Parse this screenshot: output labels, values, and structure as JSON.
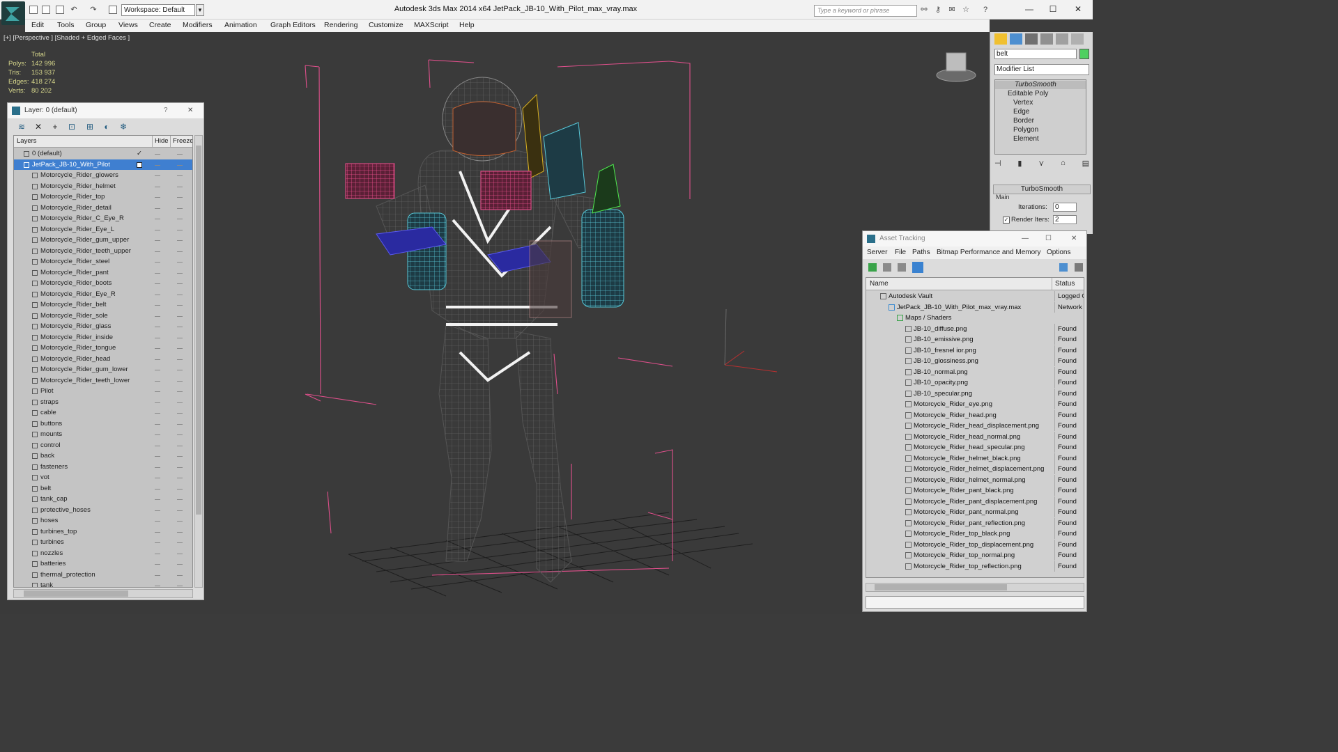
{
  "titlebar": {
    "workspace": "Workspace: Default",
    "app_title": "Autodesk 3ds Max  2014 x64       JetPack_JB-10_With_Pilot_max_vray.max",
    "search_placeholder": "Type a keyword or phrase"
  },
  "menu": [
    "Edit",
    "Tools",
    "Group",
    "Views",
    "Create",
    "Modifiers",
    "Animation",
    "Graph Editors",
    "Rendering",
    "Customize",
    "MAXScript",
    "Help"
  ],
  "viewport": {
    "label": "[+] [Perspective ] [Shaded + Edged Faces ]",
    "stats": {
      "header": "Total",
      "rows": [
        {
          "k": "Polys:",
          "v": "142 996"
        },
        {
          "k": "Tris:",
          "v": "153 937"
        },
        {
          "k": "Edges:",
          "v": "418 274"
        },
        {
          "k": "Verts:",
          "v": "80 202"
        }
      ]
    }
  },
  "layer_panel": {
    "title": "Layer: 0 (default)",
    "help": "?",
    "close": "✕",
    "col_layers": "Layers",
    "col_hide": "Hide",
    "col_freeze": "Freeze",
    "layers": [
      "0 (default)",
      "JetPack_JB-10_With_Pilot",
      "Motorcycle_Rider_glowers",
      "Motorcycle_Rider_helmet",
      "Motorcycle_Rider_top",
      "Motorcycle_Rider_detail",
      "Motorcycle_Rider_C_Eye_R",
      "Motorcycle_Rider_Eye_L",
      "Motorcycle_Rider_gum_upper",
      "Motorcycle_Rider_teeth_upper",
      "Motorcycle_Rider_steel",
      "Motorcycle_Rider_pant",
      "Motorcycle_Rider_boots",
      "Motorcycle_Rider_Eye_R",
      "Motorcycle_Rider_belt",
      "Motorcycle_Rider_sole",
      "Motorcycle_Rider_glass",
      "Motorcycle_Rider_inside",
      "Motorcycle_Rider_tongue",
      "Motorcycle_Rider_head",
      "Motorcycle_Rider_gum_lower",
      "Motorcycle_Rider_teeth_lower",
      "Pilot",
      "straps",
      "cable",
      "buttons",
      "mounts",
      "control",
      "back",
      "fasteners",
      "vot",
      "belt",
      "tank_cap",
      "protective_hoses",
      "hoses",
      "turbines_top",
      "turbines",
      "nozzles",
      "batteries",
      "thermal_protection",
      "tank"
    ]
  },
  "command_panel": {
    "object_name": "belt",
    "modifier_list": "Modifier List",
    "stack": [
      "TurboSmooth",
      "Editable Poly",
      "Vertex",
      "Edge",
      "Border",
      "Polygon",
      "Element"
    ],
    "rollout": "TurboSmooth",
    "group": "Main",
    "iterations_label": "Iterations:",
    "iterations": "0",
    "render_iters_label": "Render Iters:",
    "render_iters": "2"
  },
  "asset_panel": {
    "title": "Asset Tracking",
    "menu": [
      "Server",
      "File",
      "Paths",
      "Bitmap Performance and Memory",
      "Options"
    ],
    "col_name": "Name",
    "col_status": "Status",
    "rows": [
      {
        "indent": 1,
        "name": "Autodesk Vault",
        "status": "Logged Out"
      },
      {
        "indent": 2,
        "name": "JetPack_JB-10_With_Pilot_max_vray.max",
        "status": "Network P"
      },
      {
        "indent": 3,
        "name": "Maps / Shaders",
        "status": ""
      },
      {
        "indent": 4,
        "name": "JB-10_diffuse.png",
        "status": "Found"
      },
      {
        "indent": 4,
        "name": "JB-10_emissive.png",
        "status": "Found"
      },
      {
        "indent": 4,
        "name": "JB-10_fresnel ior.png",
        "status": "Found"
      },
      {
        "indent": 4,
        "name": "JB-10_glossiness.png",
        "status": "Found"
      },
      {
        "indent": 4,
        "name": "JB-10_normal.png",
        "status": "Found"
      },
      {
        "indent": 4,
        "name": "JB-10_opacity.png",
        "status": "Found"
      },
      {
        "indent": 4,
        "name": "JB-10_specular.png",
        "status": "Found"
      },
      {
        "indent": 4,
        "name": "Motorcycle_Rider_eye.png",
        "status": "Found"
      },
      {
        "indent": 4,
        "name": "Motorcycle_Rider_head.png",
        "status": "Found"
      },
      {
        "indent": 4,
        "name": "Motorcycle_Rider_head_displacement.png",
        "status": "Found"
      },
      {
        "indent": 4,
        "name": "Motorcycle_Rider_head_normal.png",
        "status": "Found"
      },
      {
        "indent": 4,
        "name": "Motorcycle_Rider_head_specular.png",
        "status": "Found"
      },
      {
        "indent": 4,
        "name": "Motorcycle_Rider_helmet_black.png",
        "status": "Found"
      },
      {
        "indent": 4,
        "name": "Motorcycle_Rider_helmet_displacement.png",
        "status": "Found"
      },
      {
        "indent": 4,
        "name": "Motorcycle_Rider_helmet_normal.png",
        "status": "Found"
      },
      {
        "indent": 4,
        "name": "Motorcycle_Rider_pant_black.png",
        "status": "Found"
      },
      {
        "indent": 4,
        "name": "Motorcycle_Rider_pant_displacement.png",
        "status": "Found"
      },
      {
        "indent": 4,
        "name": "Motorcycle_Rider_pant_normal.png",
        "status": "Found"
      },
      {
        "indent": 4,
        "name": "Motorcycle_Rider_pant_reflection.png",
        "status": "Found"
      },
      {
        "indent": 4,
        "name": "Motorcycle_Rider_top_black.png",
        "status": "Found"
      },
      {
        "indent": 4,
        "name": "Motorcycle_Rider_top_displacement.png",
        "status": "Found"
      },
      {
        "indent": 4,
        "name": "Motorcycle_Rider_top_normal.png",
        "status": "Found"
      },
      {
        "indent": 4,
        "name": "Motorcycle_Rider_top_reflection.png",
        "status": "Found"
      }
    ]
  },
  "colors": {
    "selection": "#3f7fd0",
    "stats_text": "#d8d88c",
    "bbox": "#e0508c"
  }
}
